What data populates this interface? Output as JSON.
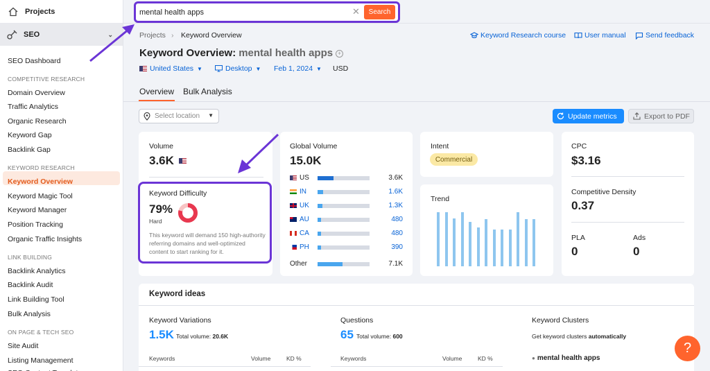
{
  "sidebar": {
    "projects": "Projects",
    "seo": "SEO",
    "items": [
      {
        "label": "SEO Dashboard"
      },
      {
        "section": "COMPETITIVE RESEARCH"
      },
      {
        "label": "Domain Overview"
      },
      {
        "label": "Traffic Analytics"
      },
      {
        "label": "Organic Research"
      },
      {
        "label": "Keyword Gap"
      },
      {
        "label": "Backlink Gap"
      },
      {
        "section": "KEYWORD RESEARCH"
      },
      {
        "label": "Keyword Overview",
        "active": true
      },
      {
        "label": "Keyword Magic Tool"
      },
      {
        "label": "Keyword Manager"
      },
      {
        "label": "Position Tracking"
      },
      {
        "label": "Organic Traffic Insights"
      },
      {
        "section": "LINK BUILDING"
      },
      {
        "label": "Backlink Analytics"
      },
      {
        "label": "Backlink Audit"
      },
      {
        "label": "Link Building Tool"
      },
      {
        "label": "Bulk Analysis"
      },
      {
        "section": "ON PAGE & TECH SEO"
      },
      {
        "label": "Site Audit"
      },
      {
        "label": "Listing Management"
      },
      {
        "label": "SEO Content Template"
      }
    ]
  },
  "search": {
    "value": "mental health apps",
    "button": "Search"
  },
  "breadcrumb": {
    "root": "Projects",
    "current": "Keyword Overview"
  },
  "toplinks": {
    "course": "Keyword Research course",
    "manual": "User manual",
    "feedback": "Send feedback"
  },
  "title": {
    "prefix": "Keyword Overview:",
    "keyword": "mental health apps"
  },
  "filters": {
    "country": "United States",
    "device": "Desktop",
    "date": "Feb 1, 2024",
    "currency": "USD"
  },
  "tabs": {
    "overview": "Overview",
    "bulk": "Bulk Analysis"
  },
  "location": {
    "placeholder": "Select location"
  },
  "buttons": {
    "update": "Update metrics",
    "export": "Export to PDF"
  },
  "volume": {
    "label": "Volume",
    "value": "3.6K"
  },
  "kd": {
    "label": "Keyword Difficulty",
    "value": "79%",
    "level": "Hard",
    "percent": 79,
    "description": "This keyword will demand 150 high-authority referring domains and well-optimized content to start ranking for it."
  },
  "global": {
    "label": "Global Volume",
    "value": "15.0K",
    "rows": [
      {
        "code": "US",
        "value": "3.6K",
        "share": 0.3,
        "link": false
      },
      {
        "code": "IN",
        "value": "1.6K",
        "share": 0.11,
        "link": true
      },
      {
        "code": "UK",
        "value": "1.3K",
        "share": 0.09,
        "link": true
      },
      {
        "code": "AU",
        "value": "480",
        "share": 0.06,
        "link": true
      },
      {
        "code": "CA",
        "value": "480",
        "share": 0.06,
        "link": true
      },
      {
        "code": "PH",
        "value": "390",
        "share": 0.05,
        "link": true
      }
    ],
    "other": {
      "label": "Other",
      "value": "7.1K",
      "share": 0.48
    }
  },
  "intent": {
    "label": "Intent",
    "value": "Commercial"
  },
  "trend": {
    "label": "Trend",
    "values": [
      1.0,
      1.0,
      0.88,
      1.0,
      0.82,
      0.72,
      0.87,
      0.68,
      0.68,
      0.68,
      1.0,
      0.87,
      0.87
    ]
  },
  "cpc": {
    "label": "CPC",
    "value": "$3.16"
  },
  "density": {
    "label": "Competitive Density",
    "value": "0.37"
  },
  "pla": {
    "label": "PLA",
    "value": "0"
  },
  "ads": {
    "label": "Ads",
    "value": "0"
  },
  "ideas": {
    "title": "Keyword ideas",
    "variations": {
      "label": "Keyword Variations",
      "value": "1.5K",
      "total_label": "Total volume:",
      "total": "20.6K"
    },
    "questions": {
      "label": "Questions",
      "value": "65",
      "total_label": "Total volume:",
      "total": "600"
    },
    "clusters": {
      "label": "Keyword Clusters",
      "desc": "Get keyword clusters ",
      "desc_bold": "automatically",
      "item": "mental health apps"
    },
    "cols": {
      "keywords": "Keywords",
      "volume": "Volume",
      "kd": "KD %"
    }
  },
  "help": "?",
  "colors": {
    "accent": "#ff642d",
    "link": "#0863d6",
    "highlight": "#6b35d6",
    "trend": "#8ec6ef"
  }
}
